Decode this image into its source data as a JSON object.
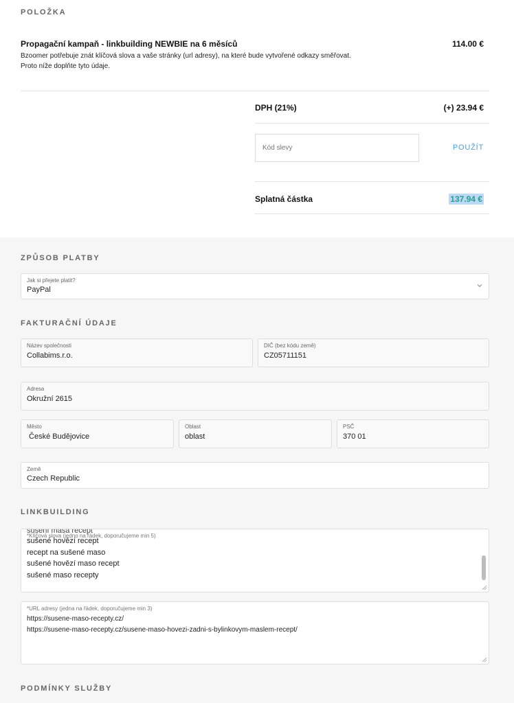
{
  "order": {
    "section_title": "POLOŽKA",
    "item_name": "Propagační kampaň - linkbuilding NEWBIE na 6 měsíců",
    "item_price": "114.00 €",
    "item_desc": "Bzoomer potřebuje znát klíčová slova a vaše stránky (url adresy), na které bude vytvořené odkazy směřovat. Proto níže doplňte tyto údaje.",
    "vat_label": "DPH (21%)",
    "vat_value": "(+) 23.94 €",
    "coupon_placeholder": "Kód slevy",
    "coupon_button": "POUŽÍT",
    "total_label": "Splatná částka",
    "total_value": "137.94 €"
  },
  "payment": {
    "section_title": "ZPŮSOB PLATBY",
    "label": "Jak si přejete platit?",
    "value": "PayPal"
  },
  "billing": {
    "section_title": "FAKTURAČNÍ ÚDAJE",
    "company_label": "Název společnosti",
    "company_value": "Collabims.r.o.",
    "dic_label": "DIČ (bez kódu země)",
    "dic_value": "CZ05711151",
    "address_label": "Adresa",
    "address_value": "Okružní 2615",
    "city_label": "Město",
    "city_value": " České Budějovice",
    "region_label": "Oblast",
    "region_value": "oblast",
    "zip_label": "PSČ",
    "zip_value": "370 01",
    "country_label": "Země",
    "country_value": "Czech Republic"
  },
  "linkbuilding": {
    "section_title": "LINKBUILDING",
    "keywords_label": "*Klíčová slova (jedno na řádek, doporučujeme min 5)",
    "keywords_clipped": "sušení masa recept",
    "keywords": [
      "sušené hovězí recept",
      "recept na sušené maso",
      "sušené hovězí maso recept",
      "sušené maso recepty"
    ],
    "urls_label": "*URL adresy (jedna na řádek, doporučujeme min 3)",
    "urls": [
      "https://susene-maso-recepty.cz/",
      "https://susene-maso-recepty.cz/susene-maso-hovezi-zadni-s-bylinkovym-maslem-recept/"
    ]
  },
  "terms": {
    "section_title": "PODMÍNKY SLUŽBY"
  },
  "colors": {
    "accent_link": "#4a9fe0",
    "total_green": "#2a9d8f",
    "total_highlight": "#b9d9f7"
  }
}
